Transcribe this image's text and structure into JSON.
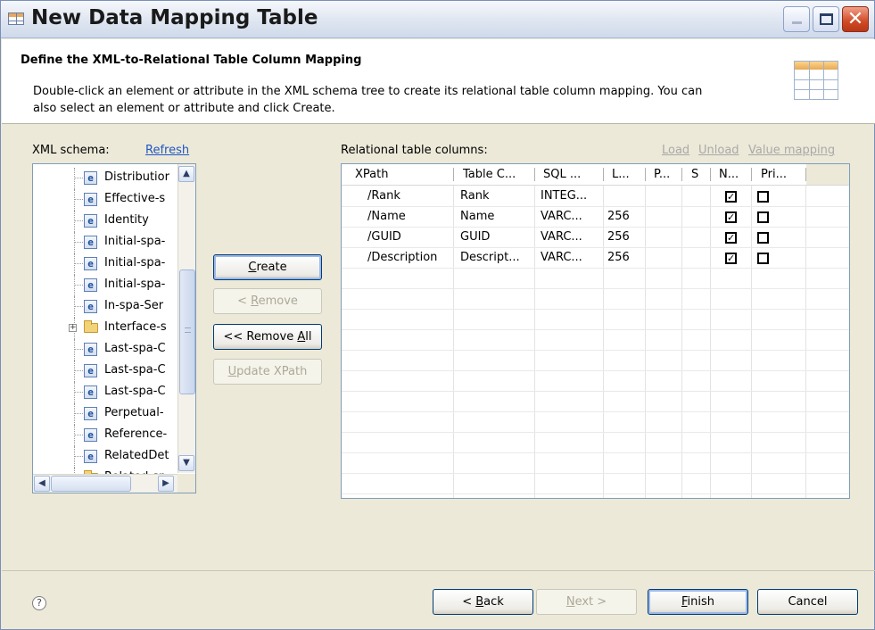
{
  "window": {
    "title": "New Data Mapping Table",
    "icon": "table-icon"
  },
  "header": {
    "title": "Define the XML-to-Relational Table Column Mapping",
    "description_line1": "Double-click an element or attribute in the XML schema tree to create its relational table column mapping. You can",
    "description_line2": "also select an element or attribute and click Create.",
    "icon": "table-banner-icon"
  },
  "schema": {
    "label": "XML schema:",
    "refresh_label": "Refresh",
    "items": [
      {
        "label": "Distributior",
        "type": "element"
      },
      {
        "label": "Effective-s",
        "type": "element"
      },
      {
        "label": "Identity",
        "type": "element"
      },
      {
        "label": "Initial-spa-",
        "type": "element"
      },
      {
        "label": "Initial-spa-",
        "type": "element"
      },
      {
        "label": "Initial-spa-",
        "type": "element"
      },
      {
        "label": "In-spa-Ser",
        "type": "element"
      },
      {
        "label": "Interface-s",
        "type": "folder"
      },
      {
        "label": "Last-spa-C",
        "type": "element"
      },
      {
        "label": "Last-spa-C",
        "type": "element"
      },
      {
        "label": "Last-spa-C",
        "type": "element"
      },
      {
        "label": "Perpetual-",
        "type": "element"
      },
      {
        "label": "Reference-",
        "type": "element"
      },
      {
        "label": "RelatedDet",
        "type": "element"
      },
      {
        "label": "Related-sp",
        "type": "folder"
      }
    ]
  },
  "actions": {
    "create": {
      "label": "Create",
      "mnemonic": "C",
      "rest": "reate"
    },
    "remove": {
      "prefix": "< ",
      "mnemonic": "R",
      "rest": "emove"
    },
    "remove_all": {
      "prefix": "<< Remove ",
      "mnemonic": "A",
      "rest": "ll"
    },
    "update_xpath": {
      "mnemonic": "U",
      "rest": "pdate XPath"
    }
  },
  "columns_panel": {
    "label": "Relational table columns:",
    "load": "Load",
    "unload": "Unload",
    "value_mapping": "Value mapping",
    "headers": [
      "XPath",
      "Table C...",
      "SQL ...",
      "L...",
      "P...",
      "S",
      "N...",
      "Pri..."
    ],
    "rows": [
      {
        "xpath": "/Rank",
        "table_column": "Rank",
        "sql": "INTEG...",
        "length": "",
        "p": "",
        "s": "",
        "nullable": true,
        "primary": false
      },
      {
        "xpath": "/Name",
        "table_column": "Name",
        "sql": "VARC...",
        "length": "256",
        "p": "",
        "s": "",
        "nullable": true,
        "primary": false
      },
      {
        "xpath": "/GUID",
        "table_column": "GUID",
        "sql": "VARC...",
        "length": "256",
        "p": "",
        "s": "",
        "nullable": true,
        "primary": false
      },
      {
        "xpath": "/Description",
        "table_column": "Descript...",
        "sql": "VARC...",
        "length": "256",
        "p": "",
        "s": "",
        "nullable": true,
        "primary": false
      }
    ]
  },
  "footer": {
    "help_icon": "help-icon",
    "back": {
      "prefix": "< ",
      "mnemonic": "B",
      "rest": "ack"
    },
    "next": {
      "mnemonic": "N",
      "rest": "ext >"
    },
    "finish": {
      "mnemonic": "F",
      "rest": "inish"
    },
    "cancel": "Cancel"
  },
  "colors": {
    "link": "#1f57c5",
    "disabled": "#a9a9a9",
    "dialog_bg": "#ece9d8"
  }
}
